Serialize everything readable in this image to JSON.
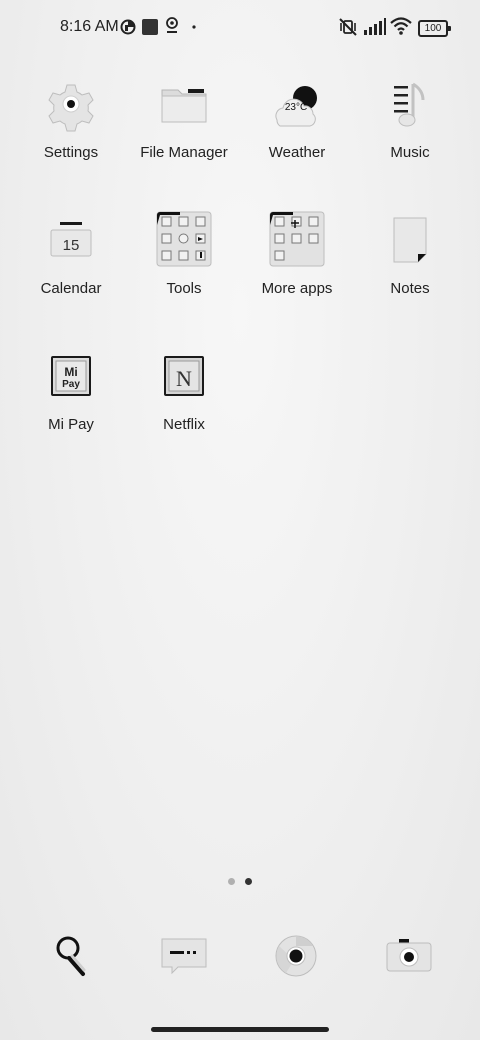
{
  "status_bar": {
    "time": "8:16 AM",
    "battery": "100",
    "icons": [
      "data-saver-icon",
      "square-notification-icon",
      "location-pin-icon",
      "dot-icon",
      "mute-vibrate-icon",
      "signal-icon",
      "wifi-icon",
      "battery-icon"
    ]
  },
  "apps": [
    {
      "label": "Settings",
      "icon": "gear-icon"
    },
    {
      "label": "File Manager",
      "icon": "folder-icon"
    },
    {
      "label": "Weather",
      "icon": "weather-icon",
      "temp": "23°C"
    },
    {
      "label": "Music",
      "icon": "music-note-icon"
    },
    {
      "label": "Calendar",
      "icon": "calendar-icon",
      "day": "15"
    },
    {
      "label": "Tools",
      "icon": "tools-folder-icon"
    },
    {
      "label": "More apps",
      "icon": "more-apps-folder-icon"
    },
    {
      "label": "Notes",
      "icon": "notes-icon"
    },
    {
      "label": "Mi Pay",
      "icon": "mi-pay-icon",
      "logo_text": "Mi Pay"
    },
    {
      "label": "Netflix",
      "icon": "netflix-icon",
      "logo_text": "N"
    }
  ],
  "pager": {
    "pages": 2,
    "active_page": 2
  },
  "dock": [
    {
      "icon": "search-icon"
    },
    {
      "icon": "messages-icon"
    },
    {
      "icon": "chrome-browser-icon"
    },
    {
      "icon": "camera-icon"
    }
  ],
  "colors": {
    "background": "#efefef",
    "text": "#222222",
    "icon_fill": "#e6e6e6",
    "icon_dark": "#1a1a1a"
  }
}
